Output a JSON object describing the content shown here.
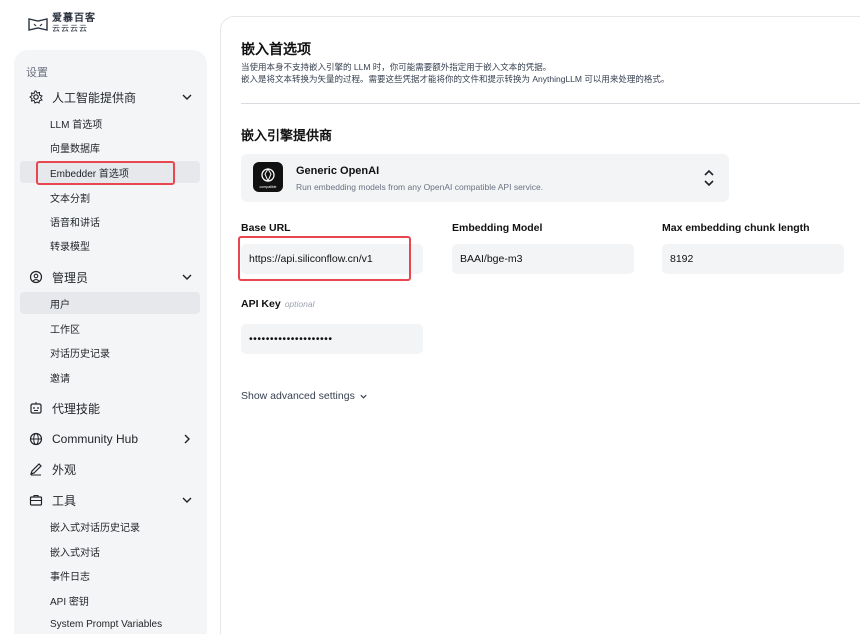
{
  "logo": {
    "line1": "爱慕百客",
    "line2": "云云云云"
  },
  "sidebar": {
    "section_label": "设置",
    "groups": [
      {
        "label": "人工智能提供商",
        "icon": "gear-icon"
      },
      {
        "label": "管理员",
        "icon": "admin-icon"
      },
      {
        "label": "代理技能",
        "icon": "robot-icon"
      },
      {
        "label": "Community Hub",
        "icon": "globe-icon"
      },
      {
        "label": "外观",
        "icon": "brush-icon"
      },
      {
        "label": "工具",
        "icon": "briefcase-icon"
      }
    ],
    "ai_items": [
      "LLM 首选项",
      "向量数据库",
      "Embedder 首选项",
      "文本分割",
      "语音和讲话",
      "转录模型"
    ],
    "admin_items": [
      "用户",
      "工作区",
      "对话历史记录",
      "邀请"
    ],
    "tools_items": [
      "嵌入式对话历史记录",
      "嵌入式对话",
      "事件日志",
      "API 密钥",
      "System Prompt Variables"
    ]
  },
  "main": {
    "title": "嵌入首选项",
    "desc_line1": "当使用本身不支持嵌入引擎的 LLM 时，你可能需要额外指定用于嵌入文本的凭据。",
    "desc_line2": "嵌入是将文本转换为矢量的过程。需要这些凭据才能将你的文件和提示转换为 AnythingLLM 可以用来处理的格式。",
    "provider_section": "嵌入引擎提供商",
    "provider": {
      "name": "Generic OpenAI",
      "desc": "Run embedding models from any OpenAI compatible API service.",
      "logo_caption": "compatible"
    },
    "fields": {
      "base_url_label": "Base URL",
      "base_url_value": "https://api.siliconflow.cn/v1",
      "model_label": "Embedding Model",
      "model_value": "BAAI/bge-m3",
      "chunk_label": "Max embedding chunk length",
      "chunk_value": "8192",
      "api_key_label": "API Key",
      "api_key_optional": "optional",
      "api_key_value": "••••••••••••••••••••"
    },
    "advanced_label": "Show advanced settings"
  },
  "colors": {
    "highlight": "#e8474f",
    "sidebar_bg": "#f4f5f7",
    "field_bg": "#f3f4f6"
  }
}
